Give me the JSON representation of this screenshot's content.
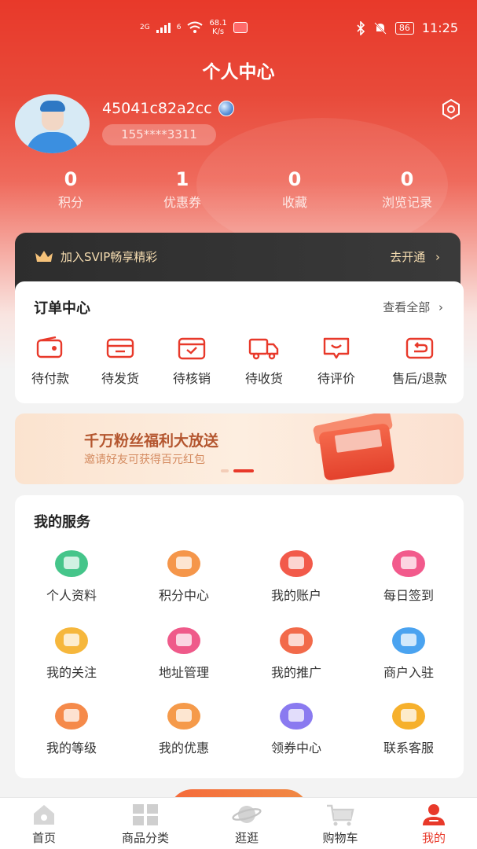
{
  "status_bar": {
    "network_left": "2G",
    "network_right": "6",
    "speed_value": "68.1",
    "speed_unit": "K/s",
    "battery": "86",
    "time": "11:25"
  },
  "page_title": "个人中心",
  "profile": {
    "username": "45041c82a2cc",
    "phone": "155****3311"
  },
  "stats": [
    {
      "value": "0",
      "label": "积分"
    },
    {
      "value": "1",
      "label": "优惠券"
    },
    {
      "value": "0",
      "label": "收藏"
    },
    {
      "value": "0",
      "label": "浏览记录"
    }
  ],
  "svip": {
    "text": "加入SVIP畅享精彩",
    "action": "去开通"
  },
  "orders": {
    "title": "订单中心",
    "view_all": "查看全部",
    "items": [
      {
        "label": "待付款",
        "icon": "wallet-icon"
      },
      {
        "label": "待发货",
        "icon": "card-icon"
      },
      {
        "label": "待核销",
        "icon": "verify-box-icon"
      },
      {
        "label": "待收货",
        "icon": "truck-icon"
      },
      {
        "label": "待评价",
        "icon": "comment-icon"
      },
      {
        "label": "售后/退款",
        "icon": "return-icon"
      }
    ]
  },
  "banner": {
    "headline": "千万粉丝福利大放送",
    "subline": "邀请好友可获得百元红包"
  },
  "services": {
    "title": "我的服务",
    "items": [
      {
        "label": "个人资料",
        "icon": "folder-icon",
        "color": "#45c58a"
      },
      {
        "label": "积分中心",
        "icon": "store-icon",
        "color": "#f5964a"
      },
      {
        "label": "我的账户",
        "icon": "account-icon",
        "color": "#f25a4a"
      },
      {
        "label": "每日签到",
        "icon": "calendar-icon",
        "color": "#f25a8c"
      },
      {
        "label": "我的关注",
        "icon": "heart-icon",
        "color": "#f6b73c"
      },
      {
        "label": "地址管理",
        "icon": "location-icon",
        "color": "#ef5a8a"
      },
      {
        "label": "我的推广",
        "icon": "megaphone-icon",
        "color": "#f26a4a"
      },
      {
        "label": "商户入驻",
        "icon": "merchant-icon",
        "color": "#4aa3f0"
      },
      {
        "label": "我的等级",
        "icon": "medal-icon",
        "color": "#f58a4a"
      },
      {
        "label": "我的优惠",
        "icon": "coupon-icon",
        "color": "#f59a4a"
      },
      {
        "label": "领券中心",
        "icon": "voucher-icon",
        "color": "#8a7af0"
      },
      {
        "label": "联系客服",
        "icon": "headset-icon",
        "color": "#f6b02c"
      }
    ]
  },
  "tabbar": {
    "items": [
      {
        "label": "首页",
        "icon": "home-icon"
      },
      {
        "label": "商品分类",
        "icon": "category-icon"
      },
      {
        "label": "逛逛",
        "icon": "planet-icon"
      },
      {
        "label": "购物车",
        "icon": "cart-icon"
      },
      {
        "label": "我的",
        "icon": "profile-icon"
      }
    ],
    "active_index": 4
  },
  "colors": {
    "brand_red": "#e8392a",
    "svip_gold": "#f5dcb0"
  }
}
